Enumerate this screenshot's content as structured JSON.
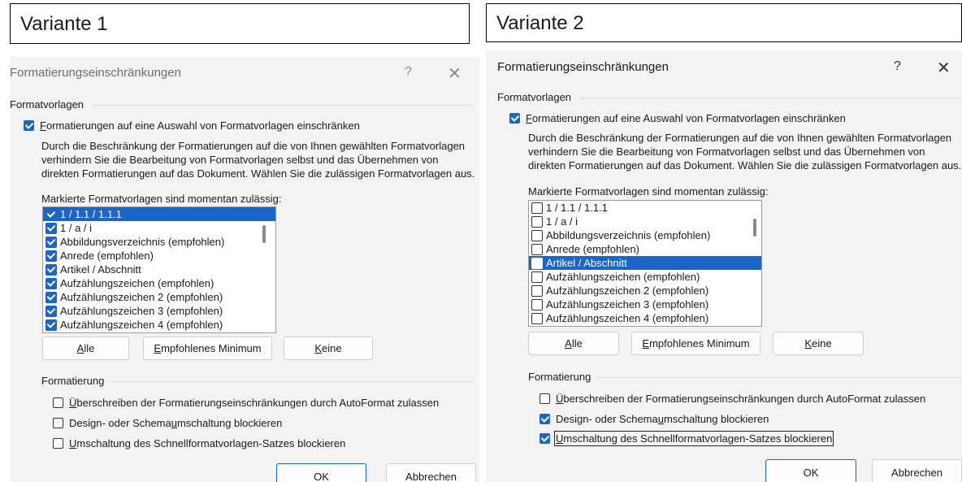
{
  "variants": [
    {
      "label": "Variante 1",
      "dialog": {
        "title": "Formatierungseinschränkungen",
        "help": "?",
        "close": "✕",
        "group_formatvorlagen": "Formatvorlagen",
        "restrict_checkbox": {
          "prefix": "F",
          "rest": "ormatierungen auf eine Auswahl von Formatvorlagen einschränken",
          "checked": true
        },
        "description": "Durch die Beschränkung der Formatierungen auf die von Ihnen gewählten Formatvorlagen verhindern Sie die Bearbeitung von Formatvorlagen selbst und das Übernehmen von direkten Formatierungen auf das Dokument. Wählen Sie die zulässigen Formatvorlagen aus.",
        "list_label": "Markierte Formatvorlagen sind momentan zulässig:",
        "list_items": [
          {
            "text": "1 / 1.1 / 1.1.1",
            "checked": true,
            "selected": true
          },
          {
            "text": "1 / a / i",
            "checked": true,
            "selected": false
          },
          {
            "text": "Abbildungsverzeichnis (empfohlen)",
            "checked": true,
            "selected": false
          },
          {
            "text": "Anrede (empfohlen)",
            "checked": true,
            "selected": false
          },
          {
            "text": "Artikel / Abschnitt",
            "checked": true,
            "selected": false
          },
          {
            "text": "Aufzählungszeichen (empfohlen)",
            "checked": true,
            "selected": false
          },
          {
            "text": "Aufzählungszeichen 2 (empfohlen)",
            "checked": true,
            "selected": false
          },
          {
            "text": "Aufzählungszeichen 3 (empfohlen)",
            "checked": true,
            "selected": false
          },
          {
            "text": "Aufzählungszeichen 4 (empfohlen)",
            "checked": true,
            "selected": false
          }
        ],
        "btn_all": {
          "u": "A",
          "rest": "lle"
        },
        "btn_min": {
          "u": "E",
          "rest": "mpfohlenes Minimum"
        },
        "btn_none": {
          "u": "K",
          "rest": "eine"
        },
        "group_formatierung": "Formatierung",
        "opt1": {
          "pre": "",
          "u": "Ü",
          "post": "berschreiben der Formatierungseinschränkungen durch AutoFormat zulassen",
          "checked": false
        },
        "opt2": {
          "pre": "Design- oder Schema",
          "u": "u",
          "post": "mschaltung blockieren",
          "checked": false
        },
        "opt3": {
          "pre": "",
          "u": "U",
          "post": "mschaltung des Schnellformatvorlagen-Satzes blockieren",
          "checked": false
        },
        "ok": "OK",
        "cancel": "Abbrechen"
      }
    },
    {
      "label": "Variante 2",
      "dialog": {
        "title": "Formatierungseinschränkungen",
        "help": "?",
        "close": "✕",
        "group_formatvorlagen": "Formatvorlagen",
        "restrict_checkbox": {
          "prefix": "F",
          "rest": "ormatierungen auf eine Auswahl von Formatvorlagen einschränken",
          "checked": true
        },
        "description": "Durch die Beschränkung der Formatierungen auf die von Ihnen gewählten Formatvorlagen verhindern Sie die Bearbeitung von Formatvorlagen selbst und das Übernehmen von direkten Formatierungen auf das Dokument. Wählen Sie die zulässigen Formatvorlagen aus.",
        "list_label": "Markierte Formatvorlagen sind momentan zulässig:",
        "list_items": [
          {
            "text": "1 / 1.1 / 1.1.1",
            "checked": false,
            "selected": false
          },
          {
            "text": "1 / a / i",
            "checked": false,
            "selected": false
          },
          {
            "text": "Abbildungsverzeichnis (empfohlen)",
            "checked": false,
            "selected": false
          },
          {
            "text": "Anrede (empfohlen)",
            "checked": false,
            "selected": false
          },
          {
            "text": "Artikel / Abschnitt",
            "checked": false,
            "selected": true
          },
          {
            "text": "Aufzählungszeichen (empfohlen)",
            "checked": false,
            "selected": false
          },
          {
            "text": "Aufzählungszeichen 2 (empfohlen)",
            "checked": false,
            "selected": false
          },
          {
            "text": "Aufzählungszeichen 3 (empfohlen)",
            "checked": false,
            "selected": false
          },
          {
            "text": "Aufzählungszeichen 4 (empfohlen)",
            "checked": false,
            "selected": false
          }
        ],
        "btn_all": {
          "u": "A",
          "rest": "lle"
        },
        "btn_min": {
          "u": "E",
          "rest": "mpfohlenes Minimum"
        },
        "btn_none": {
          "u": "K",
          "rest": "eine"
        },
        "group_formatierung": "Formatierung",
        "opt1": {
          "pre": "",
          "u": "Ü",
          "post": "berschreiben der Formatierungseinschränkungen durch AutoFormat zulassen",
          "checked": false
        },
        "opt2": {
          "pre": "Design- oder Schema",
          "u": "u",
          "post": "mschaltung blockieren",
          "checked": true
        },
        "opt3": {
          "pre": "",
          "u": "U",
          "post": "mschaltung des Schnellformatvorlagen-Satzes blockieren",
          "checked": true
        },
        "ok": "OK",
        "cancel": "Abbrechen"
      }
    }
  ]
}
